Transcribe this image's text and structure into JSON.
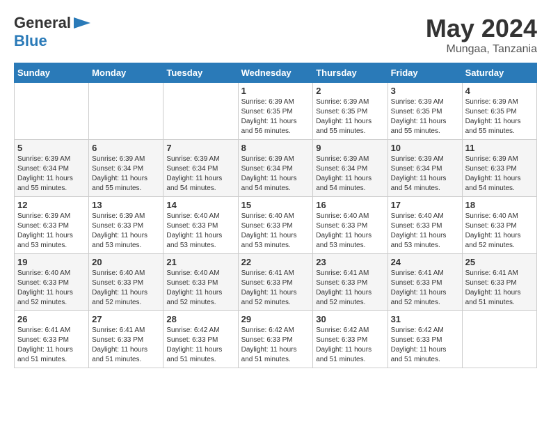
{
  "logo": {
    "general": "General",
    "blue": "Blue"
  },
  "title": {
    "month": "May 2024",
    "location": "Mungaa, Tanzania"
  },
  "headers": [
    "Sunday",
    "Monday",
    "Tuesday",
    "Wednesday",
    "Thursday",
    "Friday",
    "Saturday"
  ],
  "weeks": [
    [
      {
        "day": "",
        "sunrise": "",
        "sunset": "",
        "daylight": ""
      },
      {
        "day": "",
        "sunrise": "",
        "sunset": "",
        "daylight": ""
      },
      {
        "day": "",
        "sunrise": "",
        "sunset": "",
        "daylight": ""
      },
      {
        "day": "1",
        "sunrise": "Sunrise: 6:39 AM",
        "sunset": "Sunset: 6:35 PM",
        "daylight": "Daylight: 11 hours and 56 minutes."
      },
      {
        "day": "2",
        "sunrise": "Sunrise: 6:39 AM",
        "sunset": "Sunset: 6:35 PM",
        "daylight": "Daylight: 11 hours and 55 minutes."
      },
      {
        "day": "3",
        "sunrise": "Sunrise: 6:39 AM",
        "sunset": "Sunset: 6:35 PM",
        "daylight": "Daylight: 11 hours and 55 minutes."
      },
      {
        "day": "4",
        "sunrise": "Sunrise: 6:39 AM",
        "sunset": "Sunset: 6:35 PM",
        "daylight": "Daylight: 11 hours and 55 minutes."
      }
    ],
    [
      {
        "day": "5",
        "sunrise": "Sunrise: 6:39 AM",
        "sunset": "Sunset: 6:34 PM",
        "daylight": "Daylight: 11 hours and 55 minutes."
      },
      {
        "day": "6",
        "sunrise": "Sunrise: 6:39 AM",
        "sunset": "Sunset: 6:34 PM",
        "daylight": "Daylight: 11 hours and 55 minutes."
      },
      {
        "day": "7",
        "sunrise": "Sunrise: 6:39 AM",
        "sunset": "Sunset: 6:34 PM",
        "daylight": "Daylight: 11 hours and 54 minutes."
      },
      {
        "day": "8",
        "sunrise": "Sunrise: 6:39 AM",
        "sunset": "Sunset: 6:34 PM",
        "daylight": "Daylight: 11 hours and 54 minutes."
      },
      {
        "day": "9",
        "sunrise": "Sunrise: 6:39 AM",
        "sunset": "Sunset: 6:34 PM",
        "daylight": "Daylight: 11 hours and 54 minutes."
      },
      {
        "day": "10",
        "sunrise": "Sunrise: 6:39 AM",
        "sunset": "Sunset: 6:34 PM",
        "daylight": "Daylight: 11 hours and 54 minutes."
      },
      {
        "day": "11",
        "sunrise": "Sunrise: 6:39 AM",
        "sunset": "Sunset: 6:33 PM",
        "daylight": "Daylight: 11 hours and 54 minutes."
      }
    ],
    [
      {
        "day": "12",
        "sunrise": "Sunrise: 6:39 AM",
        "sunset": "Sunset: 6:33 PM",
        "daylight": "Daylight: 11 hours and 53 minutes."
      },
      {
        "day": "13",
        "sunrise": "Sunrise: 6:39 AM",
        "sunset": "Sunset: 6:33 PM",
        "daylight": "Daylight: 11 hours and 53 minutes."
      },
      {
        "day": "14",
        "sunrise": "Sunrise: 6:40 AM",
        "sunset": "Sunset: 6:33 PM",
        "daylight": "Daylight: 11 hours and 53 minutes."
      },
      {
        "day": "15",
        "sunrise": "Sunrise: 6:40 AM",
        "sunset": "Sunset: 6:33 PM",
        "daylight": "Daylight: 11 hours and 53 minutes."
      },
      {
        "day": "16",
        "sunrise": "Sunrise: 6:40 AM",
        "sunset": "Sunset: 6:33 PM",
        "daylight": "Daylight: 11 hours and 53 minutes."
      },
      {
        "day": "17",
        "sunrise": "Sunrise: 6:40 AM",
        "sunset": "Sunset: 6:33 PM",
        "daylight": "Daylight: 11 hours and 53 minutes."
      },
      {
        "day": "18",
        "sunrise": "Sunrise: 6:40 AM",
        "sunset": "Sunset: 6:33 PM",
        "daylight": "Daylight: 11 hours and 52 minutes."
      }
    ],
    [
      {
        "day": "19",
        "sunrise": "Sunrise: 6:40 AM",
        "sunset": "Sunset: 6:33 PM",
        "daylight": "Daylight: 11 hours and 52 minutes."
      },
      {
        "day": "20",
        "sunrise": "Sunrise: 6:40 AM",
        "sunset": "Sunset: 6:33 PM",
        "daylight": "Daylight: 11 hours and 52 minutes."
      },
      {
        "day": "21",
        "sunrise": "Sunrise: 6:40 AM",
        "sunset": "Sunset: 6:33 PM",
        "daylight": "Daylight: 11 hours and 52 minutes."
      },
      {
        "day": "22",
        "sunrise": "Sunrise: 6:41 AM",
        "sunset": "Sunset: 6:33 PM",
        "daylight": "Daylight: 11 hours and 52 minutes."
      },
      {
        "day": "23",
        "sunrise": "Sunrise: 6:41 AM",
        "sunset": "Sunset: 6:33 PM",
        "daylight": "Daylight: 11 hours and 52 minutes."
      },
      {
        "day": "24",
        "sunrise": "Sunrise: 6:41 AM",
        "sunset": "Sunset: 6:33 PM",
        "daylight": "Daylight: 11 hours and 52 minutes."
      },
      {
        "day": "25",
        "sunrise": "Sunrise: 6:41 AM",
        "sunset": "Sunset: 6:33 PM",
        "daylight": "Daylight: 11 hours and 51 minutes."
      }
    ],
    [
      {
        "day": "26",
        "sunrise": "Sunrise: 6:41 AM",
        "sunset": "Sunset: 6:33 PM",
        "daylight": "Daylight: 11 hours and 51 minutes."
      },
      {
        "day": "27",
        "sunrise": "Sunrise: 6:41 AM",
        "sunset": "Sunset: 6:33 PM",
        "daylight": "Daylight: 11 hours and 51 minutes."
      },
      {
        "day": "28",
        "sunrise": "Sunrise: 6:42 AM",
        "sunset": "Sunset: 6:33 PM",
        "daylight": "Daylight: 11 hours and 51 minutes."
      },
      {
        "day": "29",
        "sunrise": "Sunrise: 6:42 AM",
        "sunset": "Sunset: 6:33 PM",
        "daylight": "Daylight: 11 hours and 51 minutes."
      },
      {
        "day": "30",
        "sunrise": "Sunrise: 6:42 AM",
        "sunset": "Sunset: 6:33 PM",
        "daylight": "Daylight: 11 hours and 51 minutes."
      },
      {
        "day": "31",
        "sunrise": "Sunrise: 6:42 AM",
        "sunset": "Sunset: 6:33 PM",
        "daylight": "Daylight: 11 hours and 51 minutes."
      },
      {
        "day": "",
        "sunrise": "",
        "sunset": "",
        "daylight": ""
      }
    ]
  ]
}
